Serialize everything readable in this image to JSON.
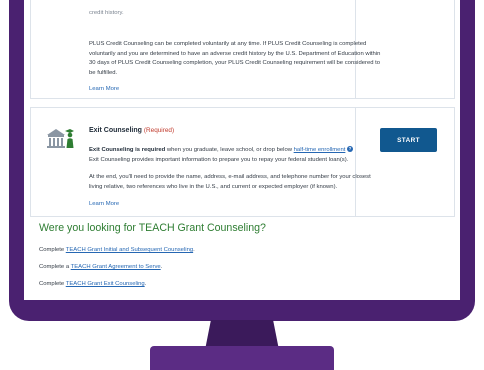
{
  "plus_section": {
    "cutoff_text": "credit history.",
    "paragraph": "PLUS Credit Counseling can be completed voluntarily at any time. If PLUS Credit Counseling is completed voluntarily and you are determined to have an adverse credit history by the U.S. Department of Education within 30 days of PLUS Credit Counseling completion, your PLUS Credit Counseling requirement will be considered to be fulfilled.",
    "learn_more": "Learn More"
  },
  "exit_section": {
    "title": "Exit Counseling",
    "required_tag": "(Required)",
    "req_bold": "Exit Counseling is required",
    "req_text": " when you graduate, leave school, or drop below ",
    "req_link": "half-time enrollment",
    "help_glyph": "?",
    "info": "Exit Counseling provides important information to prepare you to repay your federal student loan(s).",
    "details": "At the end, you'll need to provide the name, address, e-mail address, and telephone number for your closest living relative, two references who live in the U.S., and current or expected employer (if known).",
    "learn_more": "Learn More",
    "start_label": "START"
  },
  "teach": {
    "heading": "Were you looking for TEACH Grant Counseling?",
    "items": [
      {
        "prefix": "Complete ",
        "link": "TEACH Grant Initial and Subsequent Counseling",
        "suffix": "."
      },
      {
        "prefix": "Complete a ",
        "link": "TEACH Grant Agreement to Serve",
        "suffix": "."
      },
      {
        "prefix": "Complete ",
        "link": "TEACH Grant Exit Counseling",
        "suffix": "."
      }
    ]
  },
  "colors": {
    "frame": "#4a2170",
    "start_button": "#11588f",
    "link": "#2567b3",
    "teach_heading": "#2e7d32",
    "required": "#c0392b"
  },
  "icons": {
    "exit_icon": "graduate-school-icon",
    "help": "question-circle-icon"
  }
}
